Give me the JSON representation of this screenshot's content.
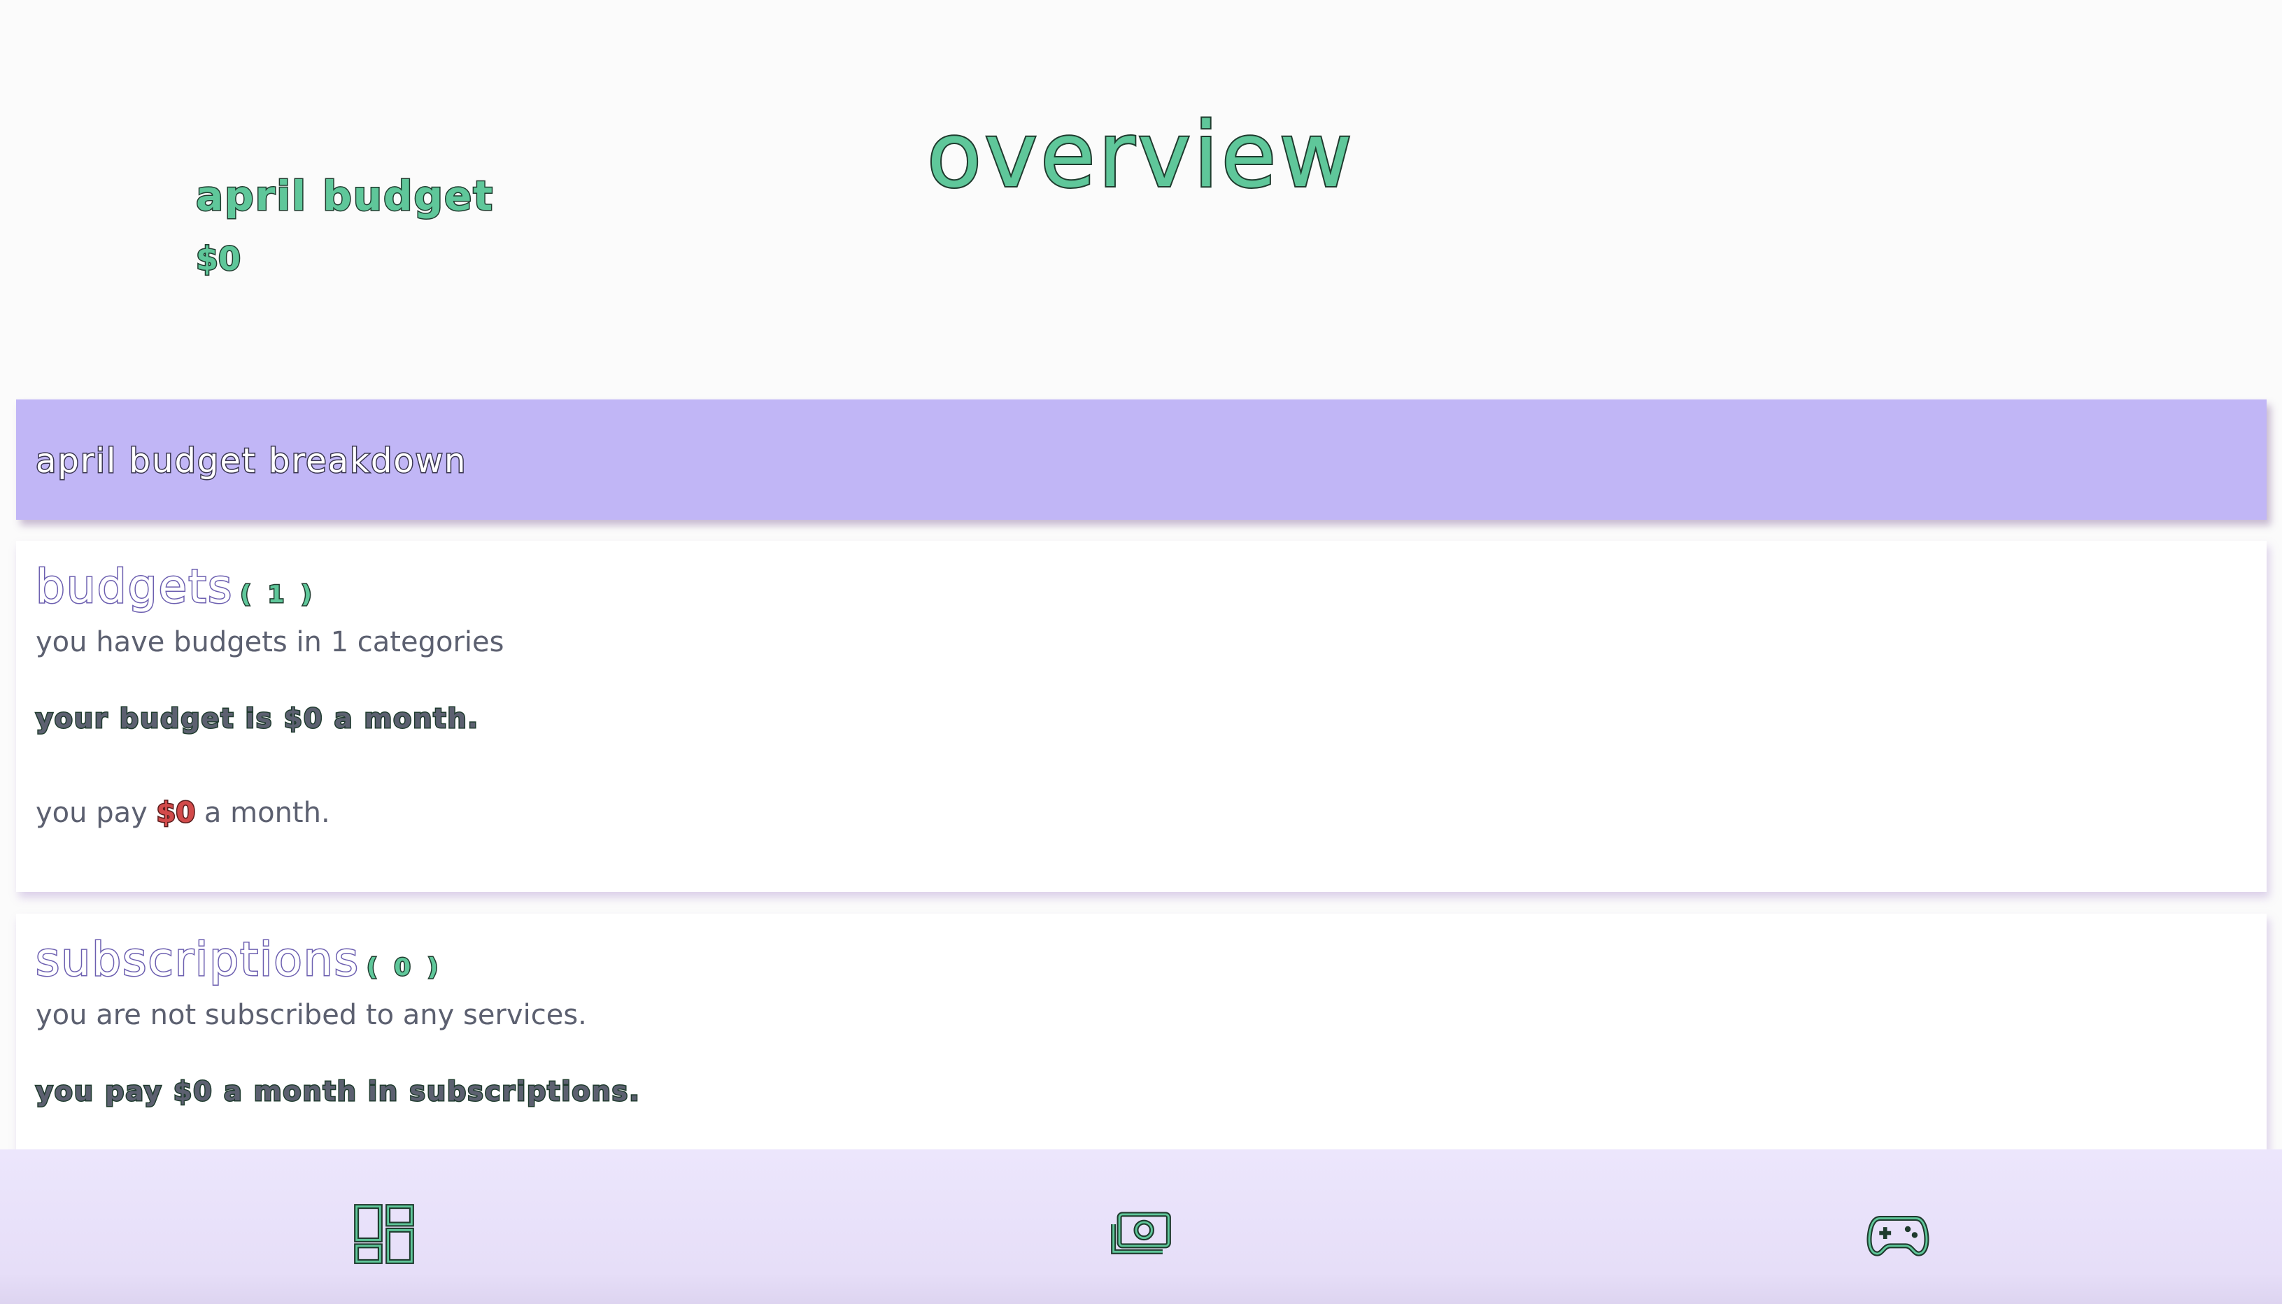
{
  "header": {
    "title": "overview"
  },
  "month_summary": {
    "title": "april budget",
    "amount": "$0"
  },
  "breakdown": {
    "title": "april budget breakdown"
  },
  "budgets_card": {
    "heading": "budgets",
    "count": "( 1 )",
    "categories_text": "you have budgets in 1 categories",
    "budget_text": "your budget is $0 a month.",
    "pay_prefix": "you pay",
    "pay_amount": "$0",
    "pay_suffix": "a month."
  },
  "subscriptions_card": {
    "heading": "subscriptions",
    "count": "( 0 )",
    "status_text": "you are not subscribed to any services.",
    "pay_text": "you pay $0 a month in subscriptions."
  },
  "bottom_nav": {
    "items": [
      {
        "icon": "dashboard-icon"
      },
      {
        "icon": "money-icon"
      },
      {
        "icon": "gamepad-icon"
      }
    ]
  },
  "colors": {
    "accent_green": "#5fc79a",
    "banner_purple": "#c1b6f6",
    "heading_purple": "#6c5fb0",
    "danger_red": "#d24a4a",
    "nav_background": "#ece6fc"
  }
}
